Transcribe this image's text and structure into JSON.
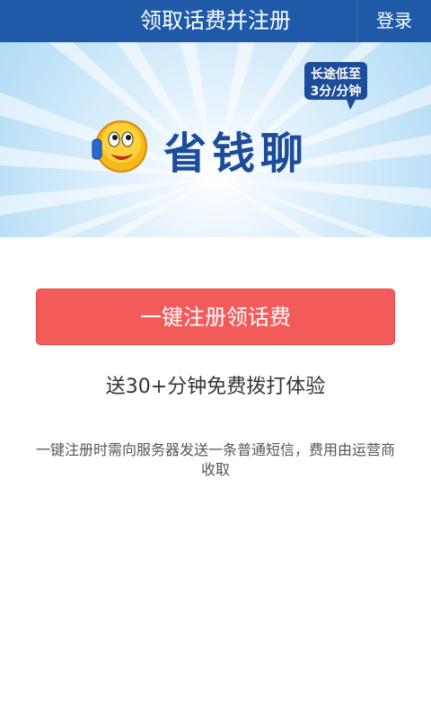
{
  "header": {
    "title": "领取话费并注册",
    "login_label": "登录"
  },
  "banner": {
    "brand_name": "省钱聊",
    "badge_line1": "长途低至",
    "badge_line2": "3分/分钟"
  },
  "main": {
    "register_button_label": "一键注册领话费",
    "promo_text": "送30+分钟免费拨打体验",
    "notice_text": "一键注册时需向服务器发送一条普通短信，费用由运营商收取"
  },
  "colors": {
    "header_bg": "#1f5aa8",
    "register_button_bg": "#f35b5a",
    "brand_text": "#1c4c9a"
  }
}
